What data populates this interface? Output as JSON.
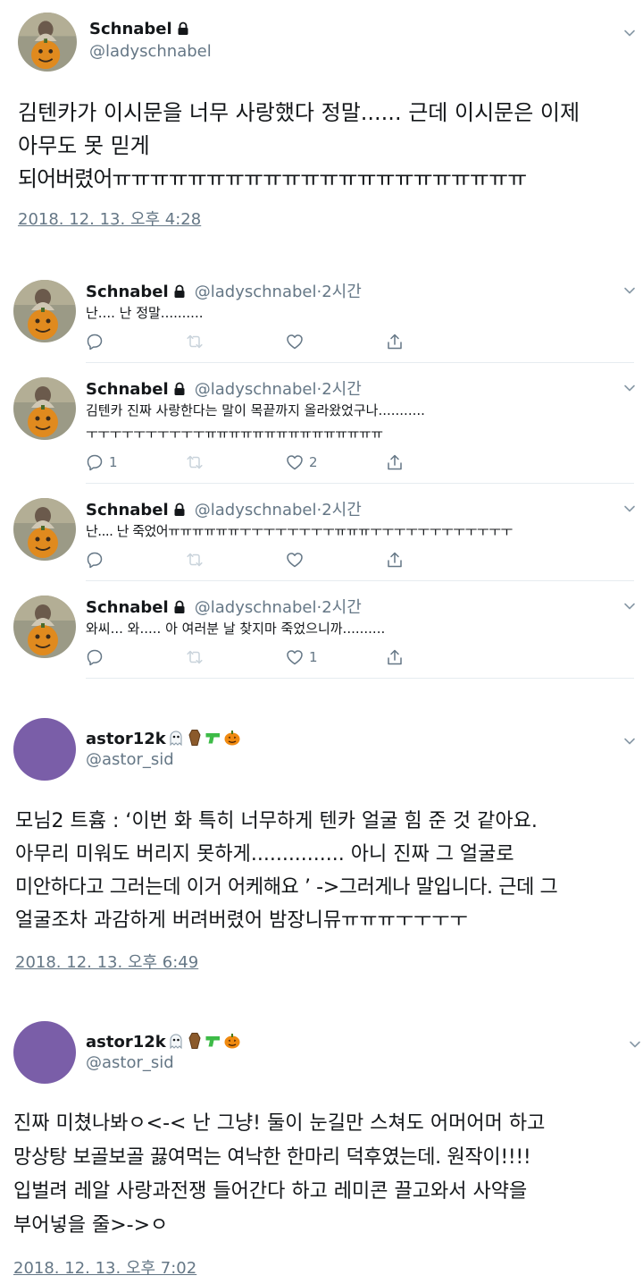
{
  "main_tweet": {
    "name": "Schnabel",
    "handle": "@ladyschnabel",
    "lines": [
      "김텐카가 이시문을 너무 사랑했다 정말...... 근데 이시문은 이제",
      "아무도 못 믿게",
      "되어버렸어ㅠㅠㅠㅠㅠㅠㅠㅠㅠㅠㅠㅠㅠㅠㅠㅠㅠㅠㅠㅠㅠㅠ"
    ],
    "date": "2018. 12. 13. 오후 4:28"
  },
  "replies": [
    {
      "name": "Schnabel",
      "handle": "@ladyschnabel",
      "time": "2시간",
      "lines": [
        "난.... 난 정말.........."
      ],
      "reply_count": "",
      "like_count": ""
    },
    {
      "name": "Schnabel",
      "handle": "@ladyschnabel",
      "time": "2시간",
      "lines": [
        "김텐카 진짜 사랑한다는 말이 목끝까지 올라왔었구나...........",
        "ㅜㅜㅜㅜㅜㅜㅜㅜㅜㅜㅠㅠㅠㅠㅠㅠㅠㅠㅠㅠㅠㅠㅠㅠㅠ"
      ],
      "reply_count": "1",
      "like_count": "2"
    },
    {
      "name": "Schnabel",
      "handle": "@ladyschnabel",
      "time": "2시간",
      "lines": [
        "난.... 난 죽었어ㅠㅠㅠㅠㅠㅠㅜㅜㅜㅜㅜㅜㅜㅜㅠㅠㅠㅜㅜㅜㅜㅜㅜㅜㅜㅜㅜㅜㅜ"
      ],
      "reply_count": "",
      "like_count": ""
    },
    {
      "name": "Schnabel",
      "handle": "@ladyschnabel",
      "time": "2시간",
      "lines": [
        "와씨... 와..... 아 여러분 날 찾지마 죽었으니까.........."
      ],
      "reply_count": "",
      "like_count": "1"
    }
  ],
  "tweet_a": {
    "name": "astor12k",
    "handle": "@astor_sid",
    "lines": [
      "모님2 트흄 : ‘이번 화 특히 너무하게 텐카 얼굴 힘 준 것 같아요.",
      "아무리 미워도 버리지 못하게............... 아니 진짜 그 얼굴로",
      "미안하다고 그러는데 이거 어케해요 ’ ->그러게나 말입니다. 근데 그",
      "얼굴조차 과감하게 버려버렸어 밤장니뮤ㅠㅠㅠㅜㅜㅜㅜ"
    ],
    "date": "2018. 12. 13. 오후 6:49"
  },
  "tweet_b": {
    "name": "astor12k",
    "handle": "@astor_sid",
    "lines": [
      "진짜 미쳤나봐ㅇ<-< 난 그냥! 둘이 눈길만 스쳐도 어머어머 하고",
      "망상탕 보골보골 끓여먹는 여낙한 한마리 덕후였는데. 원작이!!!!",
      "입벌려 레알 사랑과전쟁 들어간다 하고 레미콘 끌고와서 사약을",
      "부어넣을 줄>->ㅇ"
    ],
    "date": "2018. 12. 13. 오후 7:02"
  },
  "icons": {
    "lock": "lock-icon",
    "chevron": "chevron-down-icon",
    "reply": "reply-icon",
    "retweet": "retweet-icon",
    "like": "heart-icon",
    "share": "share-icon",
    "name_emojis": [
      "ghost-emoji",
      "coffin-emoji",
      "water-pistol-emoji",
      "jack-o-lantern-emoji"
    ]
  },
  "colors": {
    "text": "#14171a",
    "muted": "#657786",
    "divider": "#e6ecf0",
    "avatar_purple": "#7a5ea8"
  }
}
